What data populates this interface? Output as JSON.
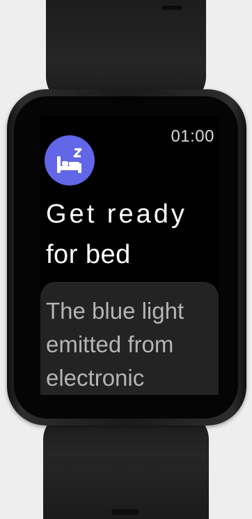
{
  "watch": {
    "time": "01:00",
    "icon": "sleep-bed-icon",
    "accent_color": "#6167e6",
    "title_line1": "Get ready",
    "title_line2": "for bed",
    "card_text": "The blue light emitted from electronic"
  }
}
